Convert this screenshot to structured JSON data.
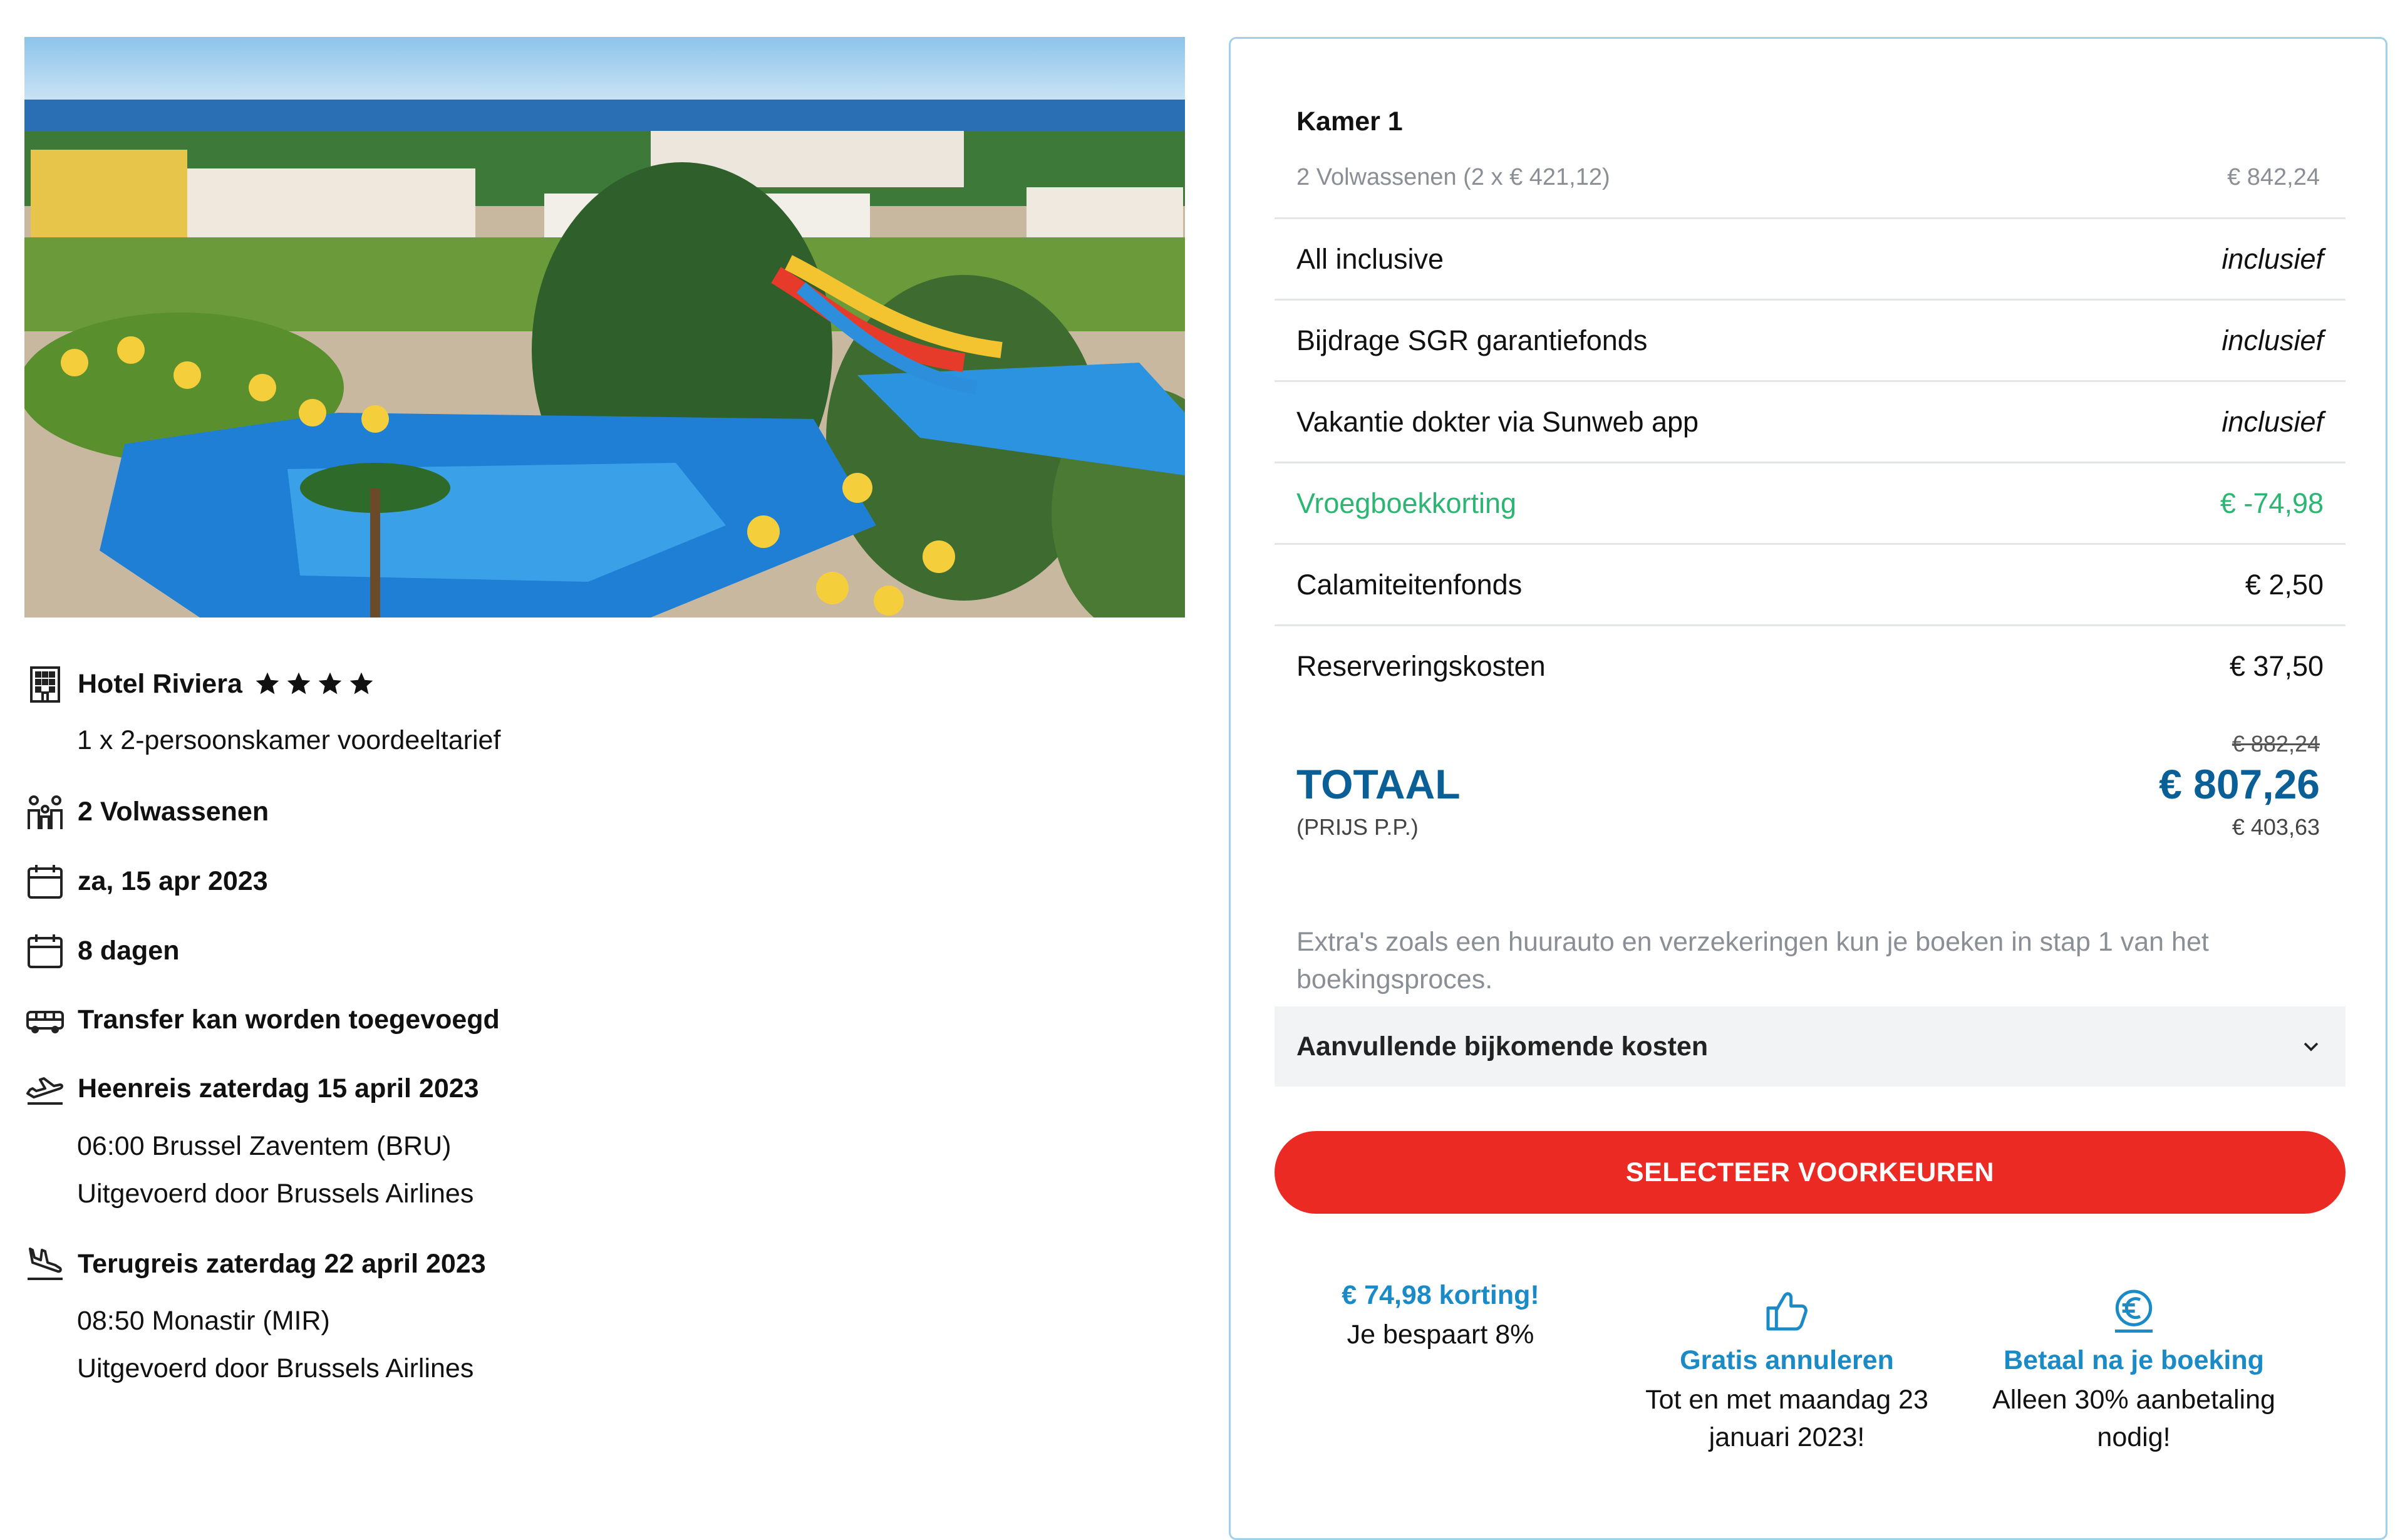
{
  "hotel": {
    "name": "Hotel Riviera",
    "stars": 4,
    "room": "1 x 2-persoonskamer voordeeltarief",
    "travelers": "2 Volwassenen",
    "date": "za, 15 apr 2023",
    "duration": "8 dagen",
    "transfer": "Transfer kan worden toegevoegd",
    "outbound": {
      "title": "Heenreis zaterdag 15 april 2023",
      "time": "06:00 Brussel Zaventem (BRU)",
      "carrier": "Uitgevoerd door Brussels Airlines"
    },
    "return": {
      "title": "Terugreis zaterdag 22 april 2023",
      "time": "08:50 Monastir (MIR)",
      "carrier": "Uitgevoerd door Brussels Airlines"
    }
  },
  "summary": {
    "room_title": "Kamer 1",
    "room_detail": "2 Volwassenen (2 x € 421,12)",
    "room_price": "€ 842,24",
    "lines": [
      {
        "label": "All inclusive",
        "value": "inclusief"
      },
      {
        "label": "Bijdrage SGR garantiefonds",
        "value": "inclusief"
      },
      {
        "label": "Vakantie dokter via Sunweb app",
        "value": "inclusief"
      },
      {
        "label": "Vroegboekkorting",
        "value": "€ -74,98"
      },
      {
        "label": "Calamiteitenfonds",
        "value": "€ 2,50"
      },
      {
        "label": "Reserveringskosten",
        "value": "€ 37,50"
      }
    ],
    "old_total": "€ 882,24",
    "total_label": "TOTAAL",
    "total": "€ 807,26",
    "pp_label": "(PRIJS P.P.)",
    "pp_price": "€ 403,63",
    "extras_note": "Extra's zoals een huurauto en verzekeringen kun je boeken in stap 1 van het boekingsproces.",
    "accordion_label": "Aanvullende bijkomende kosten",
    "cta_label": "SELECTEER VOORKEUREN",
    "accent_color": "#0a5f96",
    "discount_color": "#2bb673",
    "cta_color": "#eb2a23"
  },
  "usps": [
    {
      "title": "€ 74,98 korting!",
      "text": "Je bespaart 8%"
    },
    {
      "icon": "thumbs-up-icon",
      "title": "Gratis annuleren",
      "text": "Tot en met maandag 23 januari 2023!"
    },
    {
      "icon": "euro-coin-icon",
      "title": "Betaal na je boeking",
      "text": "Alleen 30% aanbetaling nodig!"
    }
  ]
}
